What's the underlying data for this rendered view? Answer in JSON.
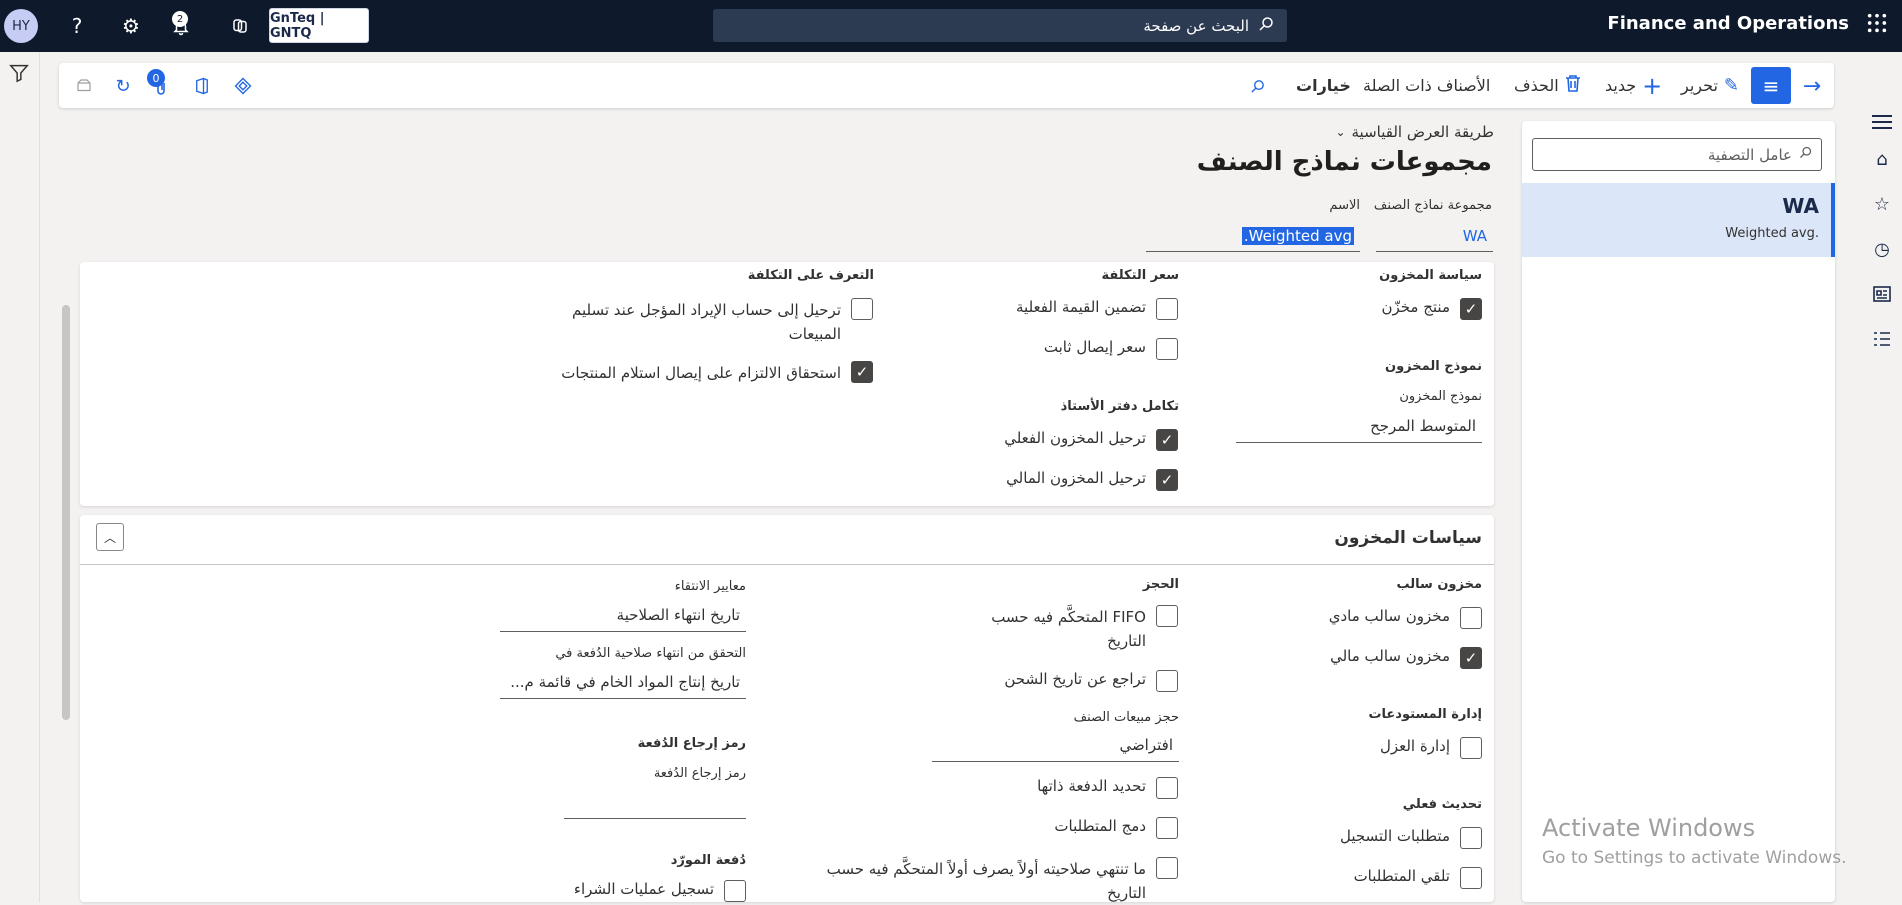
{
  "topbar": {
    "avatar": "HY",
    "notif_count": "2",
    "company": "GnTeq | GNTQ",
    "search_placeholder": "البحث عن صفحة",
    "app_title": "Finance and Operations",
    "icons": [
      "help-icon",
      "settings-icon",
      "bell-icon",
      "copilot-icon",
      "waffle-icon"
    ]
  },
  "actionbar": {
    "edit": "تحرير",
    "new": "جديد",
    "delete": "الحذف",
    "related": "الأصناف ذات الصلة",
    "options": "خيارات",
    "attach_count": "0"
  },
  "list": {
    "filter_placeholder": "عامل التصفية",
    "items": [
      {
        "code": "WA",
        "name": "Weighted avg."
      }
    ]
  },
  "header": {
    "view": "طريقة العرض القياسية",
    "title": "مجموعات نماذج الصنف",
    "group_label": "مجموعة نماذج الصنف",
    "group_value": "WA",
    "name_label": "الاسم",
    "name_value": "Weighted avg."
  },
  "setup": {
    "inv_policy_h": "سياسة المخزون",
    "stocked_product": "منتج مخزّن",
    "inv_model_h": "نموذج المخزون",
    "inv_model_label": "نموذج المخزون",
    "inv_model_value": "المتوسط المرجح",
    "cost_price_h": "سعر التكلفة",
    "include_physical": "تضمين القيمة الفعلية",
    "fixed_receipt": "سعر إيصال ثابت",
    "ledger_h": "تكامل دفتر الأستاذ",
    "post_physical": "ترحيل المخزون الفعلي",
    "post_financial": "ترحيل المخزون المالي",
    "cost_recog_h": "التعرف على التكلفة",
    "post_deferred": "ترحيل إلى حساب الإيراد المؤجل عند تسليم المبيعات",
    "accrue_liability": "استحقاق الالتزام على إيصال استلام المنتجات"
  },
  "inv_policies": {
    "section_title": "سياسات المخزون",
    "neg_h": "مخزون سالب",
    "neg_physical": "مخزون سالب مادي",
    "neg_financial": "مخزون سالب مالي",
    "wh_mgmt_h": "إدارة المستودعات",
    "quarantine": "إدارة العزل",
    "phys_update_h": "تحديث فعلي",
    "reg_req": "متطلبات التسجيل",
    "recv_req": "تلقي المتطلبات",
    "reservation_h": "الحجز",
    "fifo_date": "FIFO المتحكَّم فيه حسب التاريخ",
    "backward_ship": "تراجع عن تاريخ الشحن",
    "sales_res_h": "حجز مبيعات الصنف",
    "sales_res_value": "افتراضي",
    "batch_self": "تحديد الدفعة ذاتها",
    "merge_req": "دمج المتطلبات",
    "fefo": "ما تنتهي صلاحيته أولاً يصرف أولاً المتحكَّم فيه حسب التاريخ",
    "selection_h": "معايير الانتقاء",
    "expiry_date": "تاريخ انتهاء الصلاحية",
    "batch_check_h": "التحقق من انتهاء صلاحية الدُفعة في",
    "batch_check_value": "تاريخ إنتاج المواد الخام في قائمة م...",
    "recall_group_h": "رمز إرجاع الدُفعة",
    "recall_label": "رمز إرجاع الدُفعة",
    "vendor_batch_h": "دُفعة المورّد",
    "purchase_reg": "تسجيل عمليات الشراء"
  },
  "watermark": {
    "line1": "Activate Windows",
    "line2": "Go to Settings to activate Windows."
  }
}
